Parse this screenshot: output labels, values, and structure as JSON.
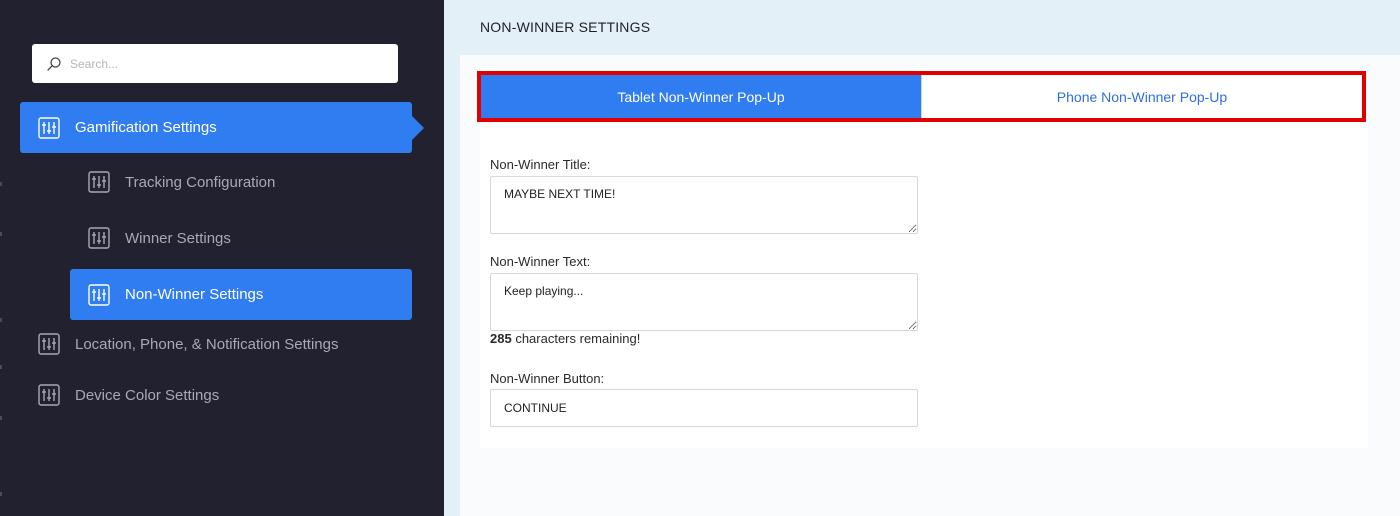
{
  "sidebar": {
    "search": {
      "placeholder": "Search..."
    },
    "items": [
      {
        "label": "Gamification Settings",
        "icon": "sliders-icon"
      },
      {
        "label": "Tracking Configuration",
        "icon": "sliders-icon"
      },
      {
        "label": "Winner Settings",
        "icon": "sliders-icon"
      },
      {
        "label": "Non-Winner Settings",
        "icon": "sliders-icon"
      },
      {
        "label": "Location, Phone, & Notification Settings",
        "icon": "sliders-icon"
      },
      {
        "label": "Device Color Settings",
        "icon": "sliders-icon"
      }
    ],
    "active_item": "Non-Winner Settings"
  },
  "main": {
    "title": "NON-WINNER SETTINGS",
    "tabs": [
      {
        "label": "Tablet Non-Winner Pop-Up",
        "active": true
      },
      {
        "label": "Phone Non-Winner Pop-Up",
        "active": false
      }
    ],
    "fields": {
      "title": {
        "label": "Non-Winner Title:",
        "value": "MAYBE NEXT TIME!"
      },
      "text": {
        "label": "Non-Winner Text:",
        "value": "Keep playing...",
        "remaining": "285",
        "remaining_suffix": " characters remaining!"
      },
      "button": {
        "label": "Non-Winner Button:",
        "value": "CONTINUE"
      }
    }
  },
  "colors": {
    "sidebar_bg": "#21212f",
    "accent": "#2f7df0",
    "main_bg": "#e4f0f8",
    "highlight_border": "#e00000"
  }
}
